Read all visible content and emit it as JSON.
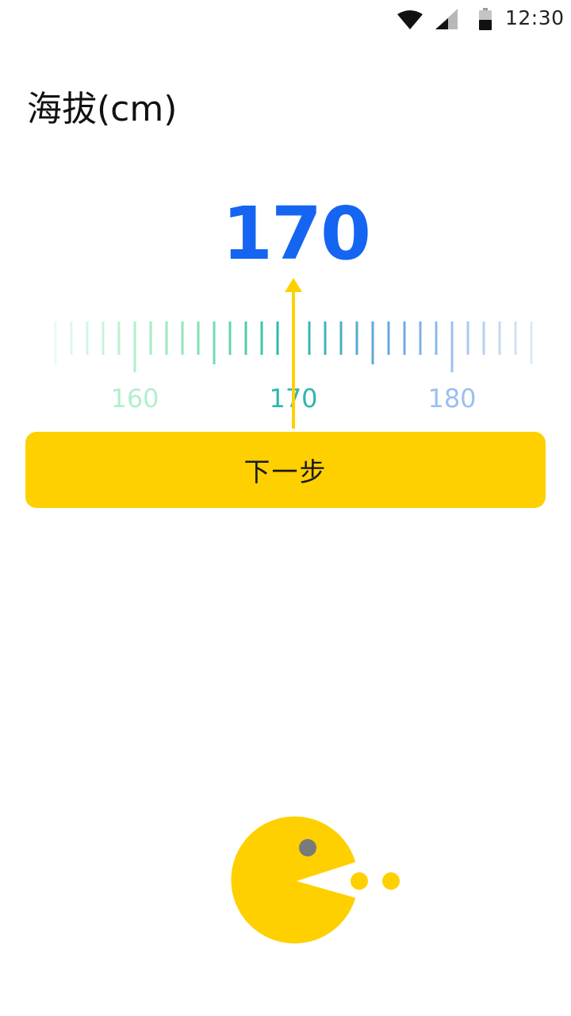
{
  "status_bar": {
    "time": "12:30",
    "icons": [
      "wifi-icon",
      "cell-signal-icon",
      "battery-icon"
    ]
  },
  "title": "海拔(cm)",
  "selected_value": "170",
  "ruler": {
    "min": 155,
    "max": 185,
    "step": 1,
    "major_step": 5,
    "labels": [
      "160",
      "170",
      "180"
    ],
    "label_values": [
      160,
      170,
      180
    ],
    "selected": 170
  },
  "next_button": {
    "label": "下一步"
  },
  "colors": {
    "accent_blue": "#1565f2",
    "yellow": "#ffd000",
    "pointer": "#ffd000",
    "eye": "#7a7a7a"
  }
}
